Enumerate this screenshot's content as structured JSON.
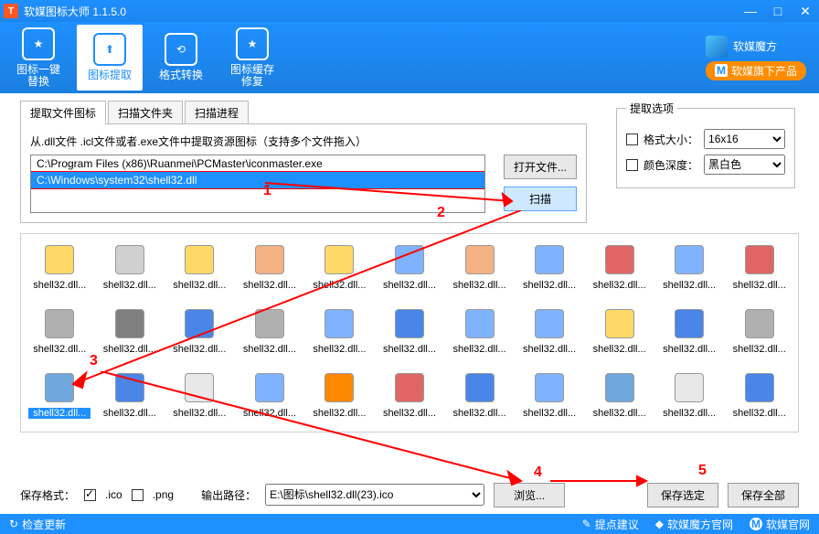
{
  "title": "软媒图标大师 1.1.5.0",
  "toolbar": [
    {
      "label": "图标一键\n替换",
      "active": false
    },
    {
      "label": "图标提取",
      "active": true
    },
    {
      "label": "格式转换",
      "active": false
    },
    {
      "label": "图标缓存\n修复",
      "active": false
    }
  ],
  "brand": {
    "name": "软媒魔方",
    "badge": "软媒旗下产品"
  },
  "tabs": [
    {
      "label": "提取文件图标",
      "active": true
    },
    {
      "label": "扫描文件夹",
      "active": false
    },
    {
      "label": "扫描进程",
      "active": false
    }
  ],
  "hint": "从.dll文件 .icl文件或者.exe文件中提取资源图标（支持多个文件拖入）",
  "files": [
    {
      "path": "C:\\Program Files (x86)\\Ruanmei\\PCMaster\\iconmaster.exe",
      "sel": false
    },
    {
      "path": "C:\\Windows\\system32\\shell32.dll",
      "sel": true
    }
  ],
  "buttons": {
    "open": "打开文件...",
    "scan": "扫描",
    "browse": "浏览...",
    "saveSel": "保存选定",
    "saveAll": "保存全部"
  },
  "options": {
    "legend": "提取选项",
    "sizeLabel": "格式大小：",
    "sizeVal": "16x16",
    "depthLabel": "颜色深度：",
    "depthVal": "黑白色"
  },
  "iconLabel": "shell32.dll...",
  "iconColors": [
    "#ffd966",
    "#d0d0d0",
    "#ffd966",
    "#f4b183",
    "#ffd966",
    "#7fb3ff",
    "#f4b183",
    "#7fb3ff",
    "#e06666",
    "#7fb3ff",
    "#e06666",
    "#b0b0b0",
    "#808080",
    "#4a86e8",
    "#b0b0b0",
    "#7fb3ff",
    "#4a86e8",
    "#7fb3ff",
    "#7fb3ff",
    "#ffd966",
    "#4a86e8",
    "#b0b0b0",
    "#6fa8dc",
    "#4a86e8",
    "#e8e8e8",
    "#7fb3ff",
    "#ff8800",
    "#e06666",
    "#4a86e8",
    "#7fb3ff",
    "#6fa8dc",
    "#e8e8e8",
    "#4a86e8"
  ],
  "selectedIcon": 22,
  "footer": {
    "fmt": "保存格式：",
    "ico": ".ico",
    "png": ".png",
    "out": "输出路径：",
    "path": "E:\\图标\\shell32.dll(23).ico"
  },
  "annotations": {
    "1": "1",
    "2": "2",
    "3": "3",
    "4": "4",
    "5": "5"
  },
  "status": {
    "check": "检查更新",
    "sug": "提点建议",
    "site": "软媒魔方官网",
    "home": "软媒官网"
  }
}
